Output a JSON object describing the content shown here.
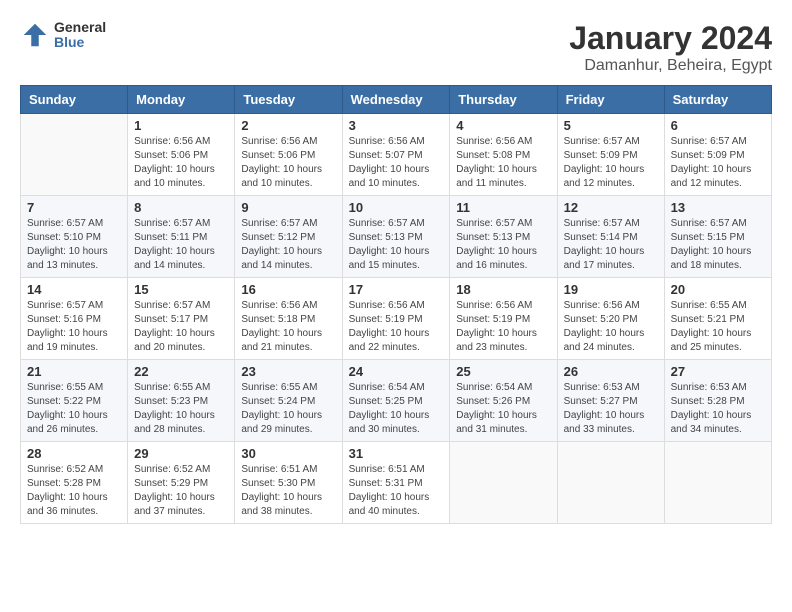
{
  "logo": {
    "general": "General",
    "blue": "Blue"
  },
  "title": "January 2024",
  "subtitle": "Damanhur, Beheira, Egypt",
  "headers": [
    "Sunday",
    "Monday",
    "Tuesday",
    "Wednesday",
    "Thursday",
    "Friday",
    "Saturday"
  ],
  "weeks": [
    [
      {
        "day": "",
        "info": ""
      },
      {
        "day": "1",
        "info": "Sunrise: 6:56 AM\nSunset: 5:06 PM\nDaylight: 10 hours\nand 10 minutes."
      },
      {
        "day": "2",
        "info": "Sunrise: 6:56 AM\nSunset: 5:06 PM\nDaylight: 10 hours\nand 10 minutes."
      },
      {
        "day": "3",
        "info": "Sunrise: 6:56 AM\nSunset: 5:07 PM\nDaylight: 10 hours\nand 10 minutes."
      },
      {
        "day": "4",
        "info": "Sunrise: 6:56 AM\nSunset: 5:08 PM\nDaylight: 10 hours\nand 11 minutes."
      },
      {
        "day": "5",
        "info": "Sunrise: 6:57 AM\nSunset: 5:09 PM\nDaylight: 10 hours\nand 12 minutes."
      },
      {
        "day": "6",
        "info": "Sunrise: 6:57 AM\nSunset: 5:09 PM\nDaylight: 10 hours\nand 12 minutes."
      }
    ],
    [
      {
        "day": "7",
        "info": "Sunrise: 6:57 AM\nSunset: 5:10 PM\nDaylight: 10 hours\nand 13 minutes."
      },
      {
        "day": "8",
        "info": "Sunrise: 6:57 AM\nSunset: 5:11 PM\nDaylight: 10 hours\nand 14 minutes."
      },
      {
        "day": "9",
        "info": "Sunrise: 6:57 AM\nSunset: 5:12 PM\nDaylight: 10 hours\nand 14 minutes."
      },
      {
        "day": "10",
        "info": "Sunrise: 6:57 AM\nSunset: 5:13 PM\nDaylight: 10 hours\nand 15 minutes."
      },
      {
        "day": "11",
        "info": "Sunrise: 6:57 AM\nSunset: 5:13 PM\nDaylight: 10 hours\nand 16 minutes."
      },
      {
        "day": "12",
        "info": "Sunrise: 6:57 AM\nSunset: 5:14 PM\nDaylight: 10 hours\nand 17 minutes."
      },
      {
        "day": "13",
        "info": "Sunrise: 6:57 AM\nSunset: 5:15 PM\nDaylight: 10 hours\nand 18 minutes."
      }
    ],
    [
      {
        "day": "14",
        "info": "Sunrise: 6:57 AM\nSunset: 5:16 PM\nDaylight: 10 hours\nand 19 minutes."
      },
      {
        "day": "15",
        "info": "Sunrise: 6:57 AM\nSunset: 5:17 PM\nDaylight: 10 hours\nand 20 minutes."
      },
      {
        "day": "16",
        "info": "Sunrise: 6:56 AM\nSunset: 5:18 PM\nDaylight: 10 hours\nand 21 minutes."
      },
      {
        "day": "17",
        "info": "Sunrise: 6:56 AM\nSunset: 5:19 PM\nDaylight: 10 hours\nand 22 minutes."
      },
      {
        "day": "18",
        "info": "Sunrise: 6:56 AM\nSunset: 5:19 PM\nDaylight: 10 hours\nand 23 minutes."
      },
      {
        "day": "19",
        "info": "Sunrise: 6:56 AM\nSunset: 5:20 PM\nDaylight: 10 hours\nand 24 minutes."
      },
      {
        "day": "20",
        "info": "Sunrise: 6:55 AM\nSunset: 5:21 PM\nDaylight: 10 hours\nand 25 minutes."
      }
    ],
    [
      {
        "day": "21",
        "info": "Sunrise: 6:55 AM\nSunset: 5:22 PM\nDaylight: 10 hours\nand 26 minutes."
      },
      {
        "day": "22",
        "info": "Sunrise: 6:55 AM\nSunset: 5:23 PM\nDaylight: 10 hours\nand 28 minutes."
      },
      {
        "day": "23",
        "info": "Sunrise: 6:55 AM\nSunset: 5:24 PM\nDaylight: 10 hours\nand 29 minutes."
      },
      {
        "day": "24",
        "info": "Sunrise: 6:54 AM\nSunset: 5:25 PM\nDaylight: 10 hours\nand 30 minutes."
      },
      {
        "day": "25",
        "info": "Sunrise: 6:54 AM\nSunset: 5:26 PM\nDaylight: 10 hours\nand 31 minutes."
      },
      {
        "day": "26",
        "info": "Sunrise: 6:53 AM\nSunset: 5:27 PM\nDaylight: 10 hours\nand 33 minutes."
      },
      {
        "day": "27",
        "info": "Sunrise: 6:53 AM\nSunset: 5:28 PM\nDaylight: 10 hours\nand 34 minutes."
      }
    ],
    [
      {
        "day": "28",
        "info": "Sunrise: 6:52 AM\nSunset: 5:28 PM\nDaylight: 10 hours\nand 36 minutes."
      },
      {
        "day": "29",
        "info": "Sunrise: 6:52 AM\nSunset: 5:29 PM\nDaylight: 10 hours\nand 37 minutes."
      },
      {
        "day": "30",
        "info": "Sunrise: 6:51 AM\nSunset: 5:30 PM\nDaylight: 10 hours\nand 38 minutes."
      },
      {
        "day": "31",
        "info": "Sunrise: 6:51 AM\nSunset: 5:31 PM\nDaylight: 10 hours\nand 40 minutes."
      },
      {
        "day": "",
        "info": ""
      },
      {
        "day": "",
        "info": ""
      },
      {
        "day": "",
        "info": ""
      }
    ]
  ]
}
